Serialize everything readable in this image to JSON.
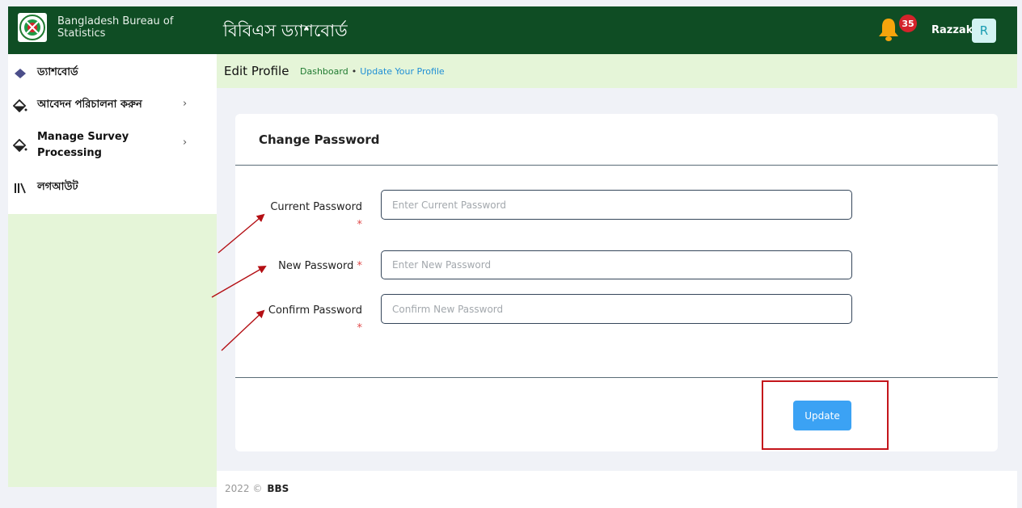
{
  "header": {
    "org_name": "Bangladesh Bureau of Statistics",
    "app_title": "বিবিএস ড্যাশবোর্ড",
    "notification_count": "35",
    "username": "Razzak",
    "avatar_initial": "R"
  },
  "sidebar": {
    "items": [
      {
        "label": "ড্যাশবোর্ড",
        "icon": "diamond-icon"
      },
      {
        "label": "আবেদন পরিচালনা করুন",
        "icon": "droplet-diamond-icon",
        "chevron": "›"
      },
      {
        "label": "Manage Survey Processing",
        "icon": "droplet-diamond-icon",
        "chevron": "›"
      },
      {
        "label": "লগআউট",
        "icon": "books-icon"
      }
    ]
  },
  "page": {
    "title": "Edit Profile",
    "breadcrumb": {
      "home": "Dashboard",
      "separator": "•",
      "current": "Update Your Profile"
    }
  },
  "form": {
    "title": "Change Password",
    "required_mark": "*",
    "fields": [
      {
        "label": "Current Password",
        "placeholder": "Enter Current Password",
        "value": ""
      },
      {
        "label": "New Password",
        "placeholder": "Enter New Password",
        "value": ""
      },
      {
        "label": "Confirm Password",
        "placeholder": "Confirm New Password",
        "value": ""
      }
    ],
    "submit_label": "Update"
  },
  "footer": {
    "year": "2022 ©",
    "name": "BBS"
  },
  "colors": {
    "header_bg": "#0f4d24",
    "light_green": "#e5f5d8",
    "button_blue": "#3ba2f4",
    "annotation_red": "#c4151b"
  }
}
